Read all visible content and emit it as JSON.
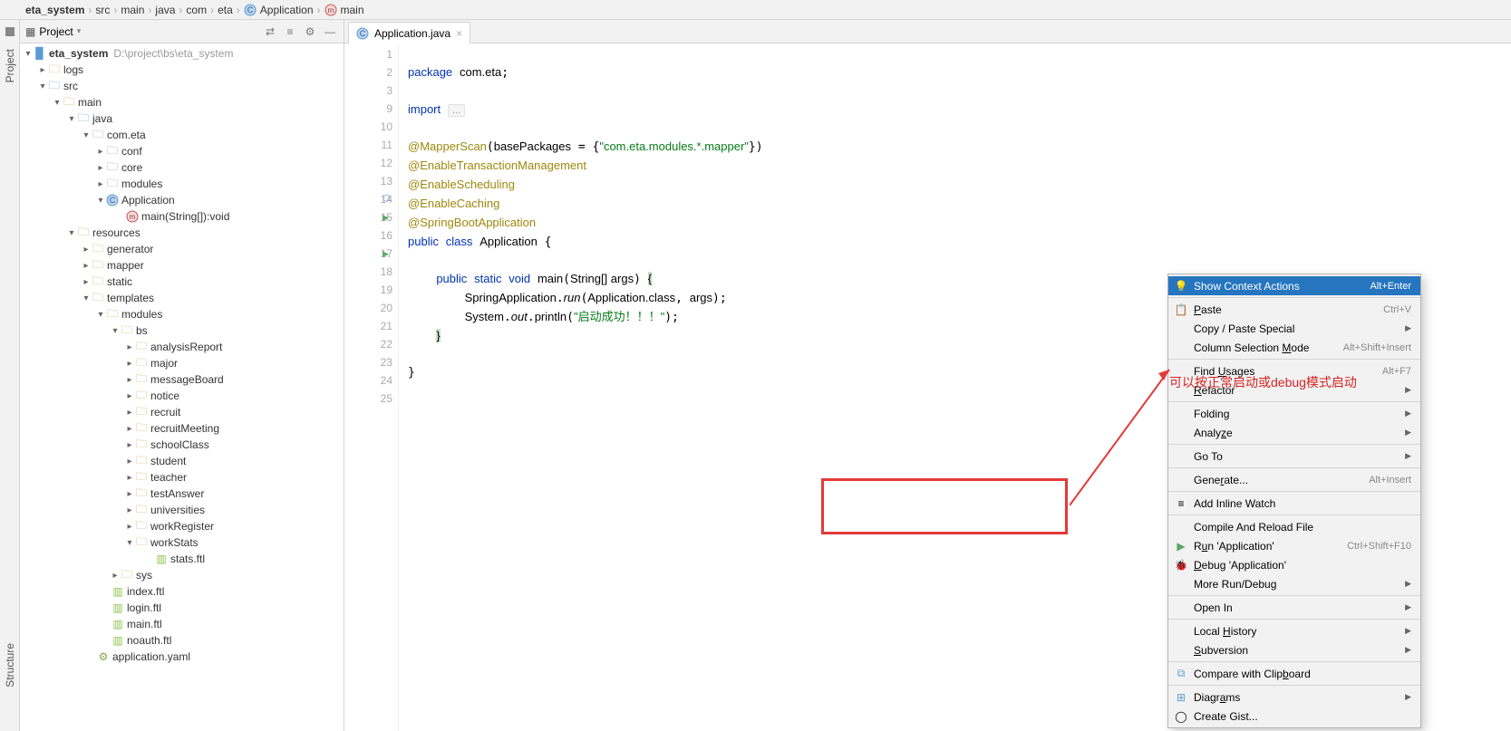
{
  "breadcrumb": {
    "items": [
      "eta_system",
      "src",
      "main",
      "java",
      "com",
      "eta",
      "Application",
      "main"
    ]
  },
  "project_panel": {
    "title": "Project",
    "root": {
      "name": "eta_system",
      "path": "D:\\project\\bs\\eta_system"
    }
  },
  "tree": {
    "logs": "logs",
    "src": "src",
    "main": "main",
    "java": "java",
    "com_eta": "com.eta",
    "conf": "conf",
    "core": "core",
    "modules": "modules",
    "application": "Application",
    "main_method": "main(String[]):void",
    "resources": "resources",
    "generator": "generator",
    "mapper": "mapper",
    "static": "static",
    "templates": "templates",
    "t_modules": "modules",
    "bs": "bs",
    "analysisReport": "analysisReport",
    "major": "major",
    "messageBoard": "messageBoard",
    "notice": "notice",
    "recruit": "recruit",
    "recruitMeeting": "recruitMeeting",
    "schoolClass": "schoolClass",
    "student": "student",
    "teacher": "teacher",
    "testAnswer": "testAnswer",
    "universities": "universities",
    "workRegister": "workRegister",
    "workStats": "workStats",
    "stats_ftl": "stats.ftl",
    "sys": "sys",
    "index_ftl": "index.ftl",
    "login_ftl": "login.ftl",
    "main_ftl": "main.ftl",
    "noauth_ftl": "noauth.ftl",
    "application_yaml": "application.yaml"
  },
  "editor": {
    "tab": "Application.java",
    "lines": {
      "l1": "1",
      "l2": "2",
      "l3": "3",
      "l9": "9",
      "l10": "10",
      "l11": "11",
      "l12": "12",
      "l13": "13",
      "l14": "14",
      "l15": "15",
      "l16": "16",
      "l17": "17",
      "l18": "18",
      "l19": "19",
      "l20": "20",
      "l21": "21",
      "l22": "22",
      "l23": "23",
      "l24": "24",
      "l25": "25"
    },
    "code": {
      "package": "package",
      "pkg_name": "com.eta",
      "import": "import",
      "dots": "...",
      "mapperscan": "@MapperScan",
      "mapperscan_arg": "(basePackages = {\"com.eta.modules.*.mapper\"})",
      "base_packages": "basePackages",
      "mapper_str": "\"com.eta.modules.*.mapper\"",
      "enable_tx": "@EnableTransactionManagement",
      "enable_sched": "@EnableScheduling",
      "enable_cache": "@EnableCaching",
      "springboot": "@SpringBootApplication",
      "public": "public",
      "class": "class",
      "static": "static",
      "void": "void",
      "app": "Application",
      "main": "main",
      "args_type": "String[] args",
      "spring_app": "SpringApplication",
      "run": "run",
      "app_class": "Application.class",
      "args": "args",
      "system": "System",
      "out": "out",
      "println": "println",
      "success_msg": "\"启动成功！！！\""
    }
  },
  "context_menu": {
    "show_actions": "Show Context Actions",
    "show_actions_sc": "Alt+Enter",
    "paste": "Paste",
    "paste_sc": "Ctrl+V",
    "copy_special": "Copy / Paste Special",
    "col_sel": "Column Selection Mode",
    "col_sel_sc": "Alt+Shift+Insert",
    "find_usages": "Find Usages",
    "find_usages_sc": "Alt+F7",
    "refactor": "Refactor",
    "folding": "Folding",
    "analyze": "Analyze",
    "goto": "Go To",
    "generate": "Generate...",
    "generate_sc": "Alt+Insert",
    "inline_watch": "Add Inline Watch",
    "compile": "Compile And Reload File",
    "run": "Run 'Application'",
    "run_sc": "Ctrl+Shift+F10",
    "debug": "Debug 'Application'",
    "more_run": "More Run/Debug",
    "open_in": "Open In",
    "local_hist": "Local History",
    "subversion": "Subversion",
    "compare_clip": "Compare with Clipboard",
    "diagrams": "Diagrams",
    "create_gist": "Create Gist..."
  },
  "annotation": {
    "text": "可以按正常启动或debug模式启动"
  },
  "rail": {
    "project": "Project",
    "structure": "Structure"
  }
}
